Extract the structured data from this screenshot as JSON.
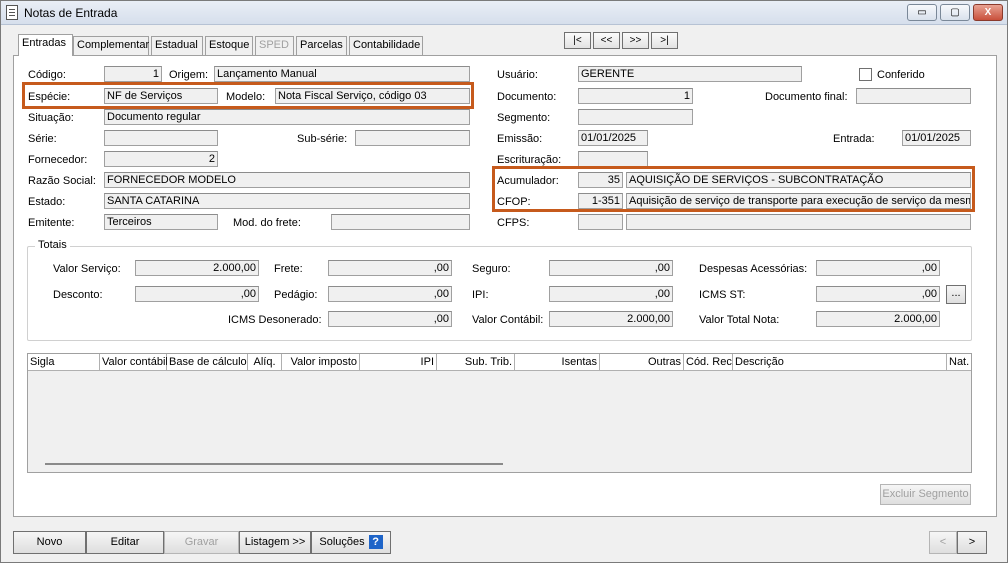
{
  "window": {
    "title": "Notas de Entrada",
    "min": "▭",
    "max": "▢",
    "close": "X"
  },
  "tabs": [
    "Entradas",
    "Complementar",
    "Estadual",
    "Estoque",
    "SPED",
    "Parcelas",
    "Contabilidade"
  ],
  "nav": {
    "first": "|<",
    "prev": "<<",
    "next": ">>",
    "last": ">|"
  },
  "form": {
    "codigo_label": "Código:",
    "codigo": "1",
    "origem_label": "Origem:",
    "origem": "Lançamento Manual",
    "especie_label": "Espécie:",
    "especie": "NF de Serviços",
    "modelo_label": "Modelo:",
    "modelo": "Nota Fiscal Serviço, código 03",
    "situacao_label": "Situação:",
    "situacao": "Documento regular",
    "serie_label": "Série:",
    "serie": "",
    "subserie_label": "Sub-série:",
    "subserie": "",
    "fornecedor_label": "Fornecedor:",
    "fornecedor": "2",
    "razao_label": "Razão Social:",
    "razao": "FORNECEDOR MODELO",
    "estado_label": "Estado:",
    "estado": "SANTA CATARINA",
    "emitente_label": "Emitente:",
    "emitente": "Terceiros",
    "modfrete_label": "Mod. do frete:",
    "modfrete": "",
    "usuario_label": "Usuário:",
    "usuario": "GERENTE",
    "conferido_label": "Conferido",
    "documento_label": "Documento:",
    "documento": "1",
    "docfinal_label": "Documento final:",
    "docfinal": "",
    "segmento_label": "Segmento:",
    "segmento": "",
    "emissao_label": "Emissão:",
    "emissao": "01/01/2025",
    "entrada_label": "Entrada:",
    "entrada": "01/01/2025",
    "escrituracao_label": "Escrituração:",
    "escrituracao": "",
    "acumulador_label": "Acumulador:",
    "acumulador": "35",
    "acumulador_desc": "AQUISIÇÃO DE SERVIÇOS - SUBCONTRATAÇÃO",
    "cfop_label": "CFOP:",
    "cfop": "1-351",
    "cfop_desc": "Aquisição de serviço de transporte para execução de serviço da mesma",
    "cfps_label": "CFPS:",
    "cfps": "",
    "cfps_desc": ""
  },
  "totais": {
    "title": "Totais",
    "valor_servico_label": "Valor Serviço:",
    "valor_servico": "2.000,00",
    "frete_label": "Frete:",
    "frete": ",00",
    "seguro_label": "Seguro:",
    "seguro": ",00",
    "despesas_label": "Despesas Acessórias:",
    "despesas": ",00",
    "desconto_label": "Desconto:",
    "desconto": ",00",
    "pedagio_label": "Pedágio:",
    "pedagio": ",00",
    "ipi_label": "IPI:",
    "ipi": ",00",
    "icmsst_label": "ICMS ST:",
    "icmsst": ",00",
    "icmsst_btn": "...",
    "icms_deson_label": "ICMS Desonerado:",
    "icms_deson": ",00",
    "valor_contabil_label": "Valor Contábil:",
    "valor_contabil": "2.000,00",
    "valor_total_label": "Valor Total Nota:",
    "valor_total": "2.000,00"
  },
  "grid_columns": [
    "Sigla",
    "Valor contábil",
    "Base de cálculo",
    "Alíq.",
    "Valor imposto",
    "IPI",
    "Sub. Trib.",
    "Isentas",
    "Outras",
    "Cód. Rec.",
    "Descrição",
    "Nat."
  ],
  "buttons": {
    "excluir_segmento": "Excluir Segmento",
    "novo": "Novo",
    "editar": "Editar",
    "gravar": "Gravar",
    "listagem": "Listagem >>",
    "solucoes": "Soluções",
    "prev": "<",
    "next": ">"
  }
}
